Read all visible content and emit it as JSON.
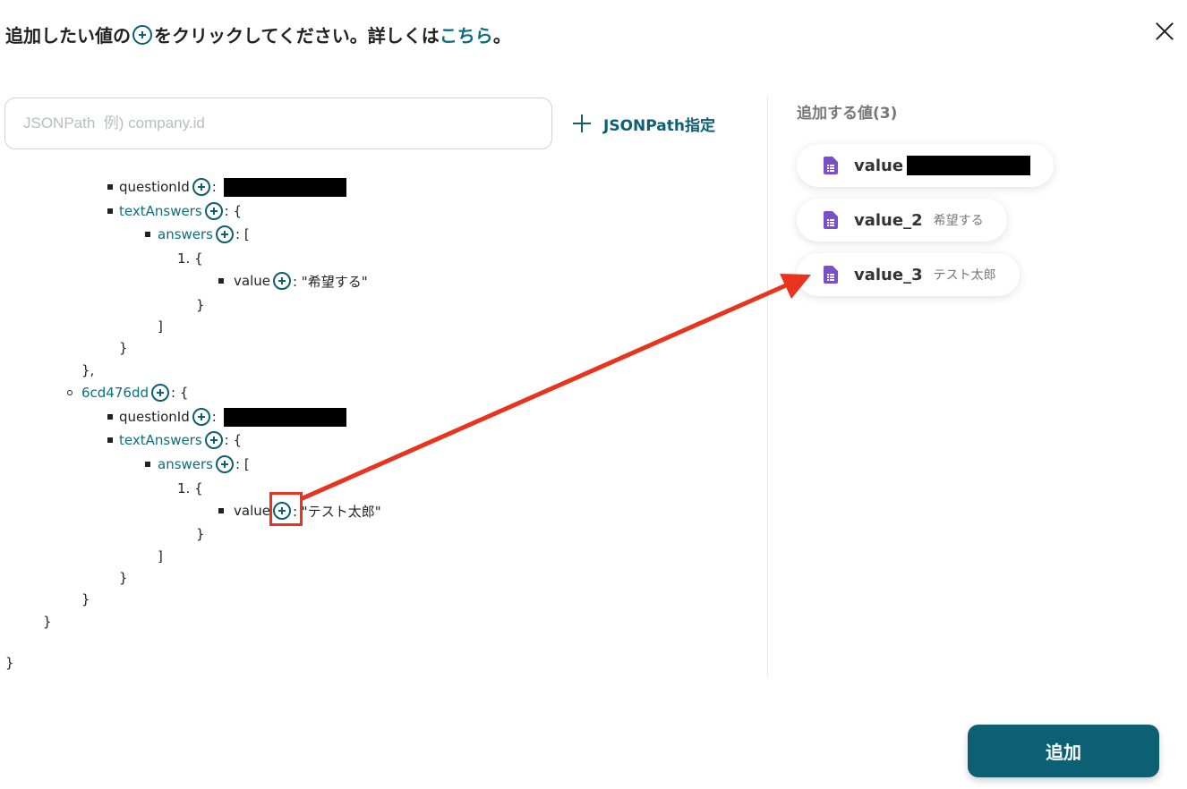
{
  "header": {
    "prefix": "追加したい値の",
    "suffix": "をクリックしてください。詳しくは",
    "link": "こちら",
    "end": "。"
  },
  "search": {
    "placeholder": "JSONPath  例) company.id",
    "value": ""
  },
  "jsonpath_button": {
    "label": "JSONPath指定"
  },
  "tree": {
    "questionId_key": "questionId",
    "textAnswers_key": "textAnswers",
    "answers_key": "answers",
    "value_key": "value",
    "open_brace": ": {",
    "open_bracket": ": [",
    "colon": ":",
    "item_1": "1. {",
    "close_brace": "}",
    "close_brace_comma": "},",
    "close_bracket": "]",
    "value_1": ": \"希望する\"",
    "value_2": ": \"テスト太郎\"",
    "block_id": "6cd476dd"
  },
  "right_panel": {
    "title": "追加する値(3)",
    "chips": [
      {
        "name": "value",
        "value": ""
      },
      {
        "name": "value_2",
        "value": "希望する"
      },
      {
        "name": "value_3",
        "value": "テスト太郎"
      }
    ]
  },
  "footer": {
    "add_label": "追加"
  },
  "colors": {
    "accent": "#0d5f73",
    "link": "#0d6e80",
    "annotation": "#e8341f",
    "doc_icon": "#7b4fc8"
  }
}
